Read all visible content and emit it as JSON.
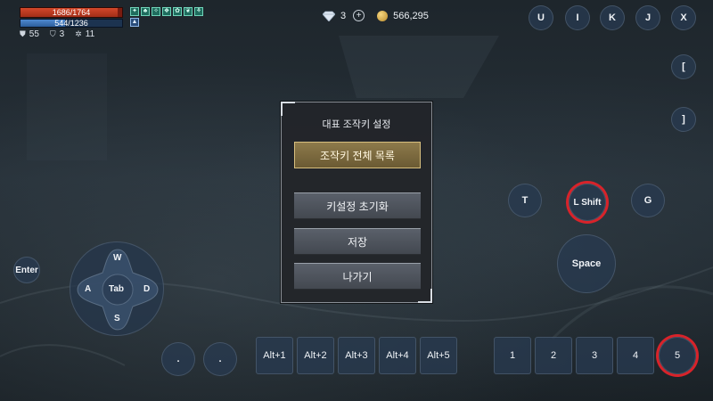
{
  "player": {
    "hp_text": "1686/1764",
    "hp_fraction": 0.956,
    "mp_text": "544/1236",
    "mp_fraction": 0.44,
    "stats": [
      {
        "icon": "shield-icon",
        "value": "55"
      },
      {
        "icon": "shield-small-icon",
        "value": "3"
      },
      {
        "icon": "gear-icon",
        "value": "11"
      }
    ],
    "buff_count": 7
  },
  "currency": {
    "diamonds": "3",
    "gold": "566,295"
  },
  "top_keys": [
    "U",
    "I",
    "K",
    "J",
    "X"
  ],
  "side_keys": [
    "[",
    "]"
  ],
  "dialog": {
    "title": "대표 조작키 설정",
    "full_list_button": "조작키 전체 목록",
    "reset_button": "키설정 초기화",
    "save_button": "저장",
    "exit_button": "나가기"
  },
  "action_keys": {
    "t": "T",
    "lshift": "L Shift",
    "g": "G",
    "space": "Space",
    "enter": "Enter"
  },
  "dpad": {
    "up": "W",
    "left": "A",
    "center": "Tab",
    "right": "D",
    "down": "S"
  },
  "dot_keys": [
    ".",
    "."
  ],
  "alt_keys": [
    "Alt+1",
    "Alt+2",
    "Alt+3",
    "Alt+4",
    "Alt+5"
  ],
  "num_keys": [
    "1",
    "2",
    "3",
    "4",
    "5"
  ],
  "colors": {
    "highlight": "#d8232a",
    "button_bg": "#283a50",
    "gold_button": "#8d7a4b"
  }
}
